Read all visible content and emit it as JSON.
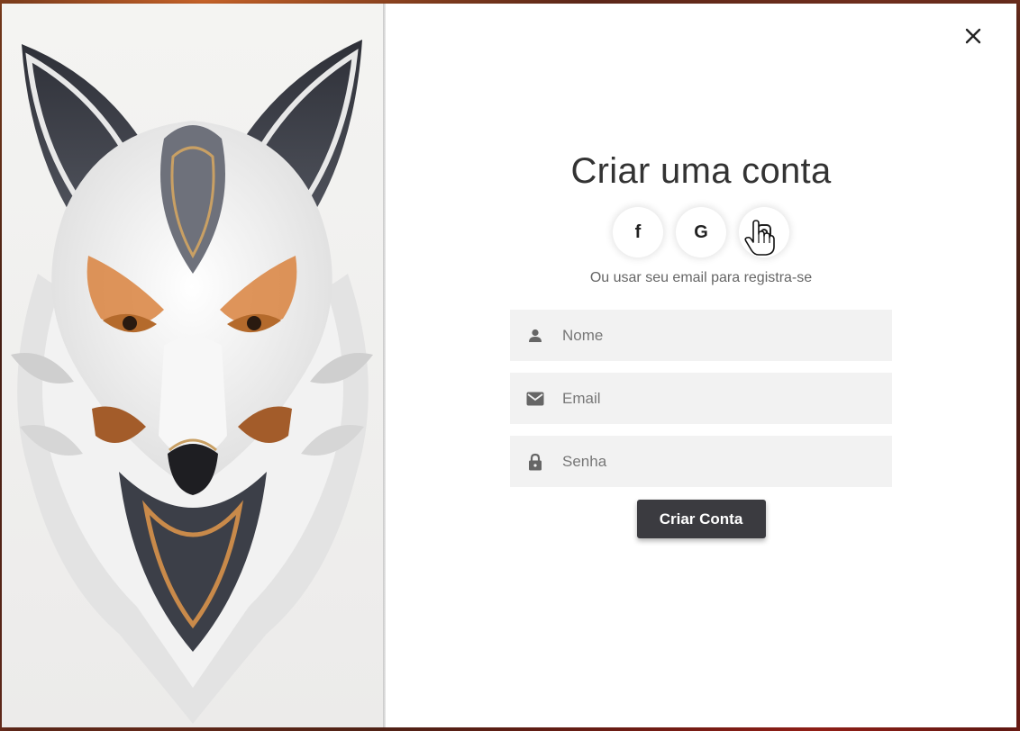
{
  "modal": {
    "close_label": "×"
  },
  "signup": {
    "title": "Criar uma conta",
    "subtitle": "Ou usar seu email para registra-se",
    "social": [
      {
        "name": "facebook",
        "glyph": "f",
        "icon": "facebook-icon"
      },
      {
        "name": "google",
        "glyph": "G",
        "icon": "google-icon"
      },
      {
        "name": "fingerprint",
        "glyph": "",
        "icon": "fingerprint-icon"
      }
    ],
    "fields": {
      "name": {
        "placeholder": "Nome",
        "value": "",
        "icon": "person-icon"
      },
      "email": {
        "placeholder": "Email",
        "value": "",
        "icon": "mail-icon"
      },
      "password": {
        "placeholder": "Senha",
        "value": "",
        "icon": "lock-icon"
      }
    },
    "submit_label": "Criar Conta"
  },
  "colors": {
    "button": "#3b3b40",
    "field_bg": "#f2f2f2",
    "fox_orange": "#d9823e"
  }
}
